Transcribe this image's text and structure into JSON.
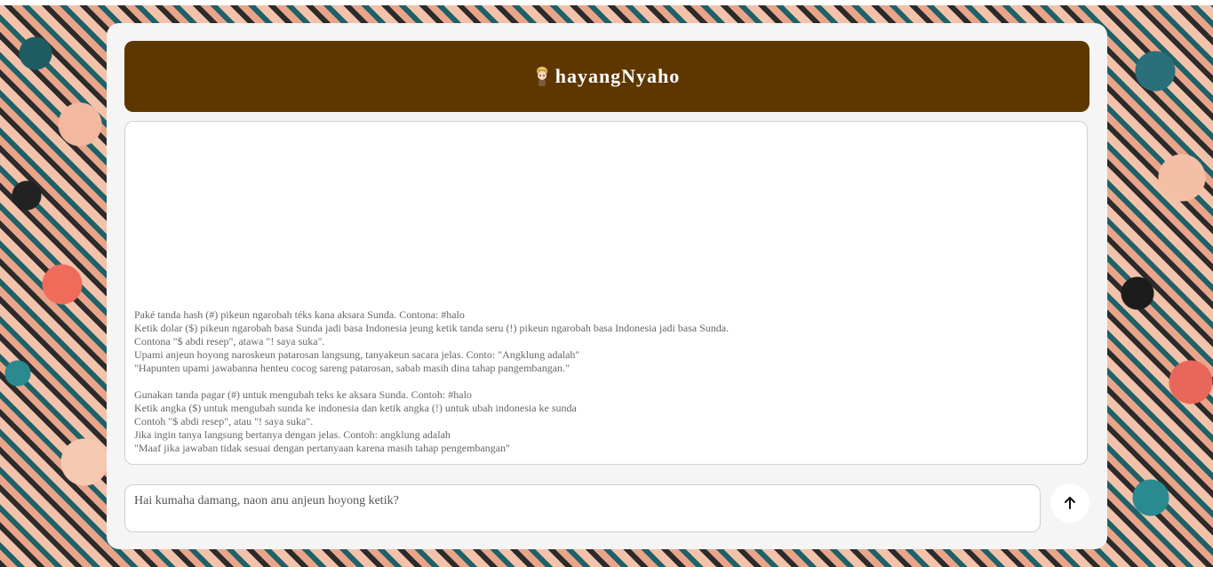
{
  "header": {
    "title": "hayangNyaho",
    "icon": "mascot-icon",
    "background_color": "#5e3700"
  },
  "chat": {
    "instructions": [
      "Paké tanda hash (#) pikeun ngarobah téks kana aksara Sunda. Contona: #halo",
      "Ketik dolar ($) pikeun ngarobah basa Sunda jadi basa Indonesia jeung ketik tanda seru (!) pikeun ngarobah basa Indonesia jadi basa Sunda.",
      "Contona \"$ abdi resep\", atawa \"! saya suka\".",
      "Upami anjeun hoyong naroskeun patarosan langsung, tanyakeun sacara jelas. Conto: \"Angklung adalah\"",
      "\"Hapunten upami jawabanna henteu cocog sareng patarosan, sabab masih dina tahap pangembangan.\"",
      "",
      "Gunakan tanda pagar (#) untuk mengubah teks ke aksara Sunda. Contoh: #halo",
      "Ketik angka ($) untuk mengubah sunda ke indonesia dan ketik angka (!) untuk ubah indonesia ke sunda",
      "Contoh \"$ abdi resep\", atau \"! saya suka\".",
      "Jika ingin tanya langsung bertanya dengan jelas. Contoh: angklung adalah",
      "\"Maaf jika jawaban tidak sesuai dengan pertanyaan karena masih tahap pengembangan\""
    ]
  },
  "composer": {
    "placeholder": "Hai kumaha damang, naon anu anjeun hoyong ketik?",
    "send_icon": "arrow-up-icon"
  }
}
